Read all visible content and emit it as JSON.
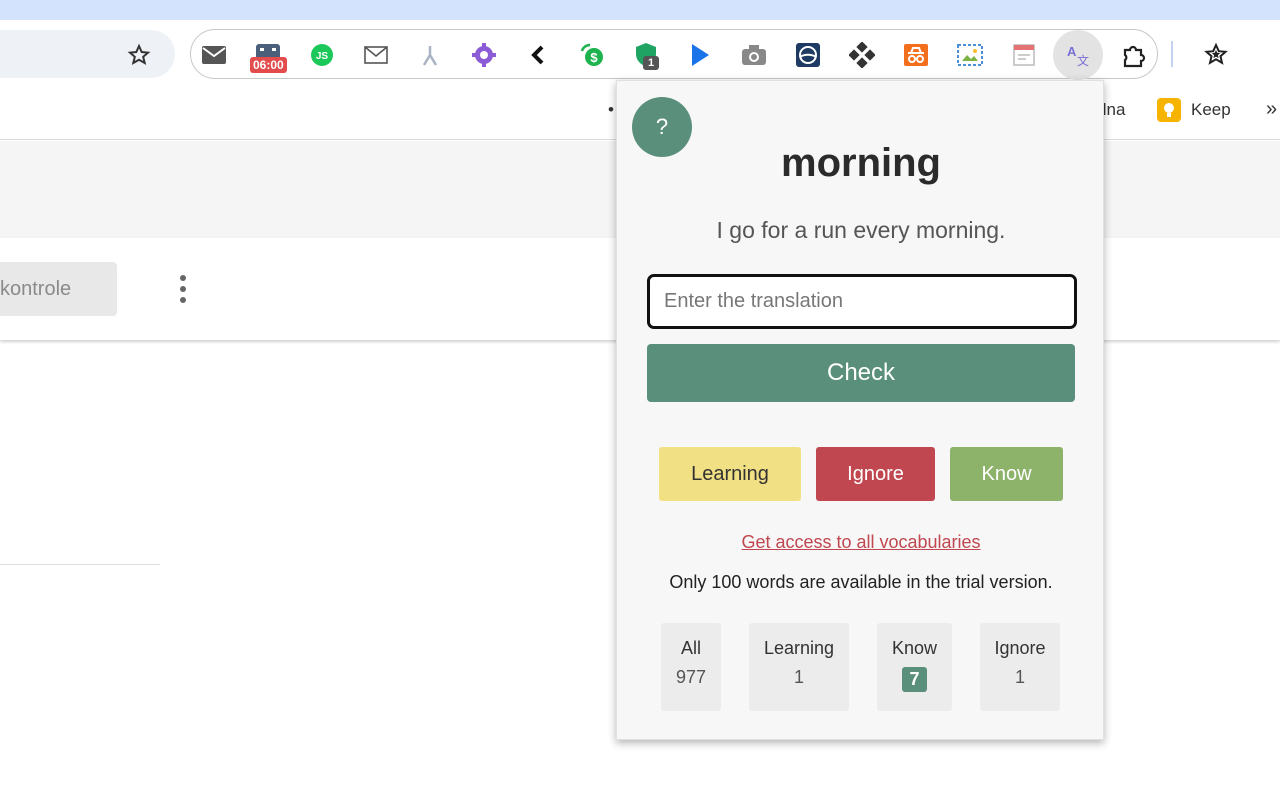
{
  "toolbar": {
    "alarm_badge": "06:00",
    "shield_badge": "1",
    "extensions": [
      "mail-icon",
      "calendar-icon",
      "js-icon",
      "envelope-icon",
      "fork-icon",
      "gear-icon",
      "chevron-left-icon",
      "money-icon",
      "shield-icon",
      "cursor-icon",
      "camera-icon",
      "ring-icon",
      "puzzle-pattern-icon",
      "incognito-icon",
      "image-icon",
      "notes-icon",
      "translate-icon",
      "extensions-puzzle-icon"
    ]
  },
  "bookmarks": {
    "left_fragment": "•",
    "fragment": "ílna",
    "keep": "Keep",
    "more": "»"
  },
  "page": {
    "kontrole_label": "kontrole"
  },
  "popup": {
    "help_label": "?",
    "word": "morning",
    "sentence": "I go for a run every morning.",
    "input_placeholder": "Enter the translation",
    "input_value": "",
    "check_label": "Check",
    "learning_label": "Learning",
    "ignore_label": "Ignore",
    "know_label": "Know",
    "access_link": "Get access to all vocabularies",
    "trial_note": "Only 100 words are available in the trial version.",
    "stats": {
      "all_label": "All",
      "all_value": "977",
      "learning_label": "Learning",
      "learning_value": "1",
      "know_label": "Know",
      "know_value": "7",
      "ignore_label": "Ignore",
      "ignore_value": "1"
    }
  },
  "colors": {
    "accent_green": "#5a8f7b",
    "learning_yellow": "#f2e084",
    "ignore_red": "#c0474f",
    "know_green": "#8db26a"
  }
}
